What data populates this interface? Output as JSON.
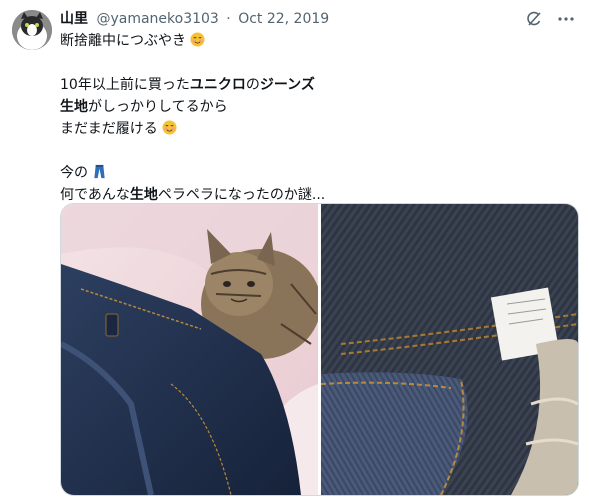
{
  "tweet": {
    "display_name": "山里",
    "handle": "@yamaneko3103",
    "separator": "·",
    "date": "Oct 22, 2019",
    "line1_text": "断捨離中につぶやき",
    "line2_pre": "10年以上前に買った",
    "line2_bold1": "ユニクロ",
    "line2_mid": "の",
    "line2_bold2": "ジーンズ",
    "line3_bold": "生地",
    "line3_post": "がしっかりしてるから",
    "line4_text": "まだまだ履ける",
    "line5_text": "今の",
    "line6_pre": "何であんな",
    "line6_bold": "生地",
    "line6_post": "ペラペラになったのか謎..."
  },
  "icons": {
    "grok": "grok-icon",
    "more": "more-icon",
    "emoji_smile": "smiling-face-icon",
    "emoji_jeans": "jeans-icon"
  },
  "colors": {
    "text": "#0f1419",
    "secondary": "#536471",
    "border": "#cfd9de"
  }
}
